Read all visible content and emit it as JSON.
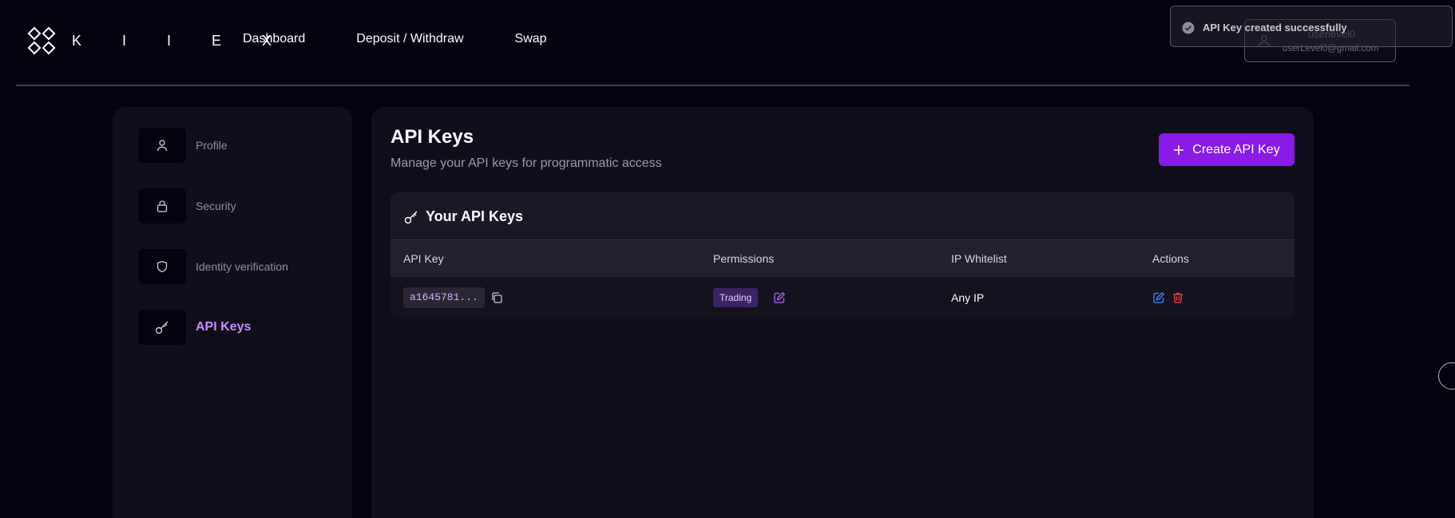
{
  "brand": {
    "logo_text": "K I I E X",
    "logo_icon": "kiiex-logo-icon"
  },
  "nav": {
    "dashboard": "Dashboard",
    "deposit_withdraw": "Deposit / Withdraw",
    "swap": "Swap"
  },
  "user": {
    "name": "userlevel0",
    "email": "userLevel0@gmail.com",
    "icon": "user-icon"
  },
  "toast": {
    "message": "API Key created successfully",
    "icon": "check-circle-icon"
  },
  "sidebar": {
    "items": [
      {
        "label": "Profile",
        "icon": "user-icon"
      },
      {
        "label": "Security",
        "icon": "lock-icon"
      },
      {
        "label": "Identity verification",
        "icon": "shield-icon"
      },
      {
        "label": "API Keys",
        "icon": "key-icon",
        "active": true
      }
    ]
  },
  "main": {
    "title": "API Keys",
    "subtitle": "Manage your API keys for programmatic access",
    "create_button": "Create API Key",
    "card_title": "Your API Keys",
    "columns": [
      "API Key",
      "Permissions",
      "IP Whitelist",
      "Actions"
    ],
    "rows": [
      {
        "api_key": "a1645781...",
        "permission": "Trading",
        "ip_whitelist": "Any IP"
      }
    ]
  },
  "colors": {
    "background": "#05020f",
    "panel": "#110e1c",
    "accent": "#8a1be6",
    "active_label": "#c88cff",
    "edit_blue": "#3b8cff",
    "delete_red": "#ef4444"
  }
}
